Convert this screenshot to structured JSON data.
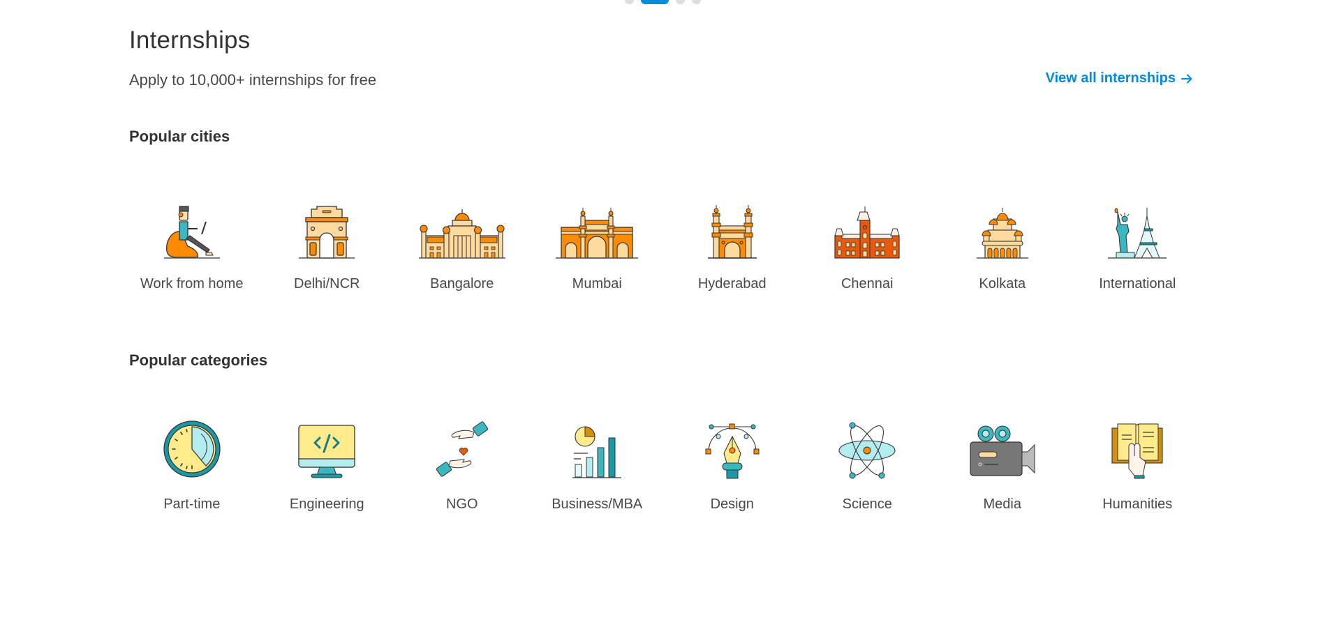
{
  "carousel": {
    "dot_count": 4,
    "active_index": 1
  },
  "header": {
    "title": "Internships",
    "subtitle": "Apply to 10,000+ internships for free",
    "view_all_label": "View all internships"
  },
  "colors": {
    "accent": "#008BDC",
    "heading": "#333333",
    "text": "#484848",
    "orange": "#FF8C00",
    "light_orange": "#FFDA9E",
    "teal": "#1A9AA6",
    "light_teal": "#B3EDF0",
    "yellow": "#FFEB8C"
  },
  "popular_cities": {
    "heading": "Popular cities",
    "items": [
      {
        "label": "Work from home",
        "icon": "person-laptop-icon"
      },
      {
        "label": "Delhi/NCR",
        "icon": "india-gate-icon"
      },
      {
        "label": "Bangalore",
        "icon": "vidhana-soudha-icon"
      },
      {
        "label": "Mumbai",
        "icon": "gateway-of-india-icon"
      },
      {
        "label": "Hyderabad",
        "icon": "charminar-icon"
      },
      {
        "label": "Chennai",
        "icon": "chennai-central-icon"
      },
      {
        "label": "Kolkata",
        "icon": "dakshineswar-temple-icon"
      },
      {
        "label": "International",
        "icon": "liberty-eiffel-icon"
      }
    ]
  },
  "popular_categories": {
    "heading": "Popular categories",
    "items": [
      {
        "label": "Part-time",
        "icon": "clock-icon"
      },
      {
        "label": "Engineering",
        "icon": "code-monitor-icon"
      },
      {
        "label": "NGO",
        "icon": "hands-heart-icon"
      },
      {
        "label": "Business/MBA",
        "icon": "bar-chart-icon"
      },
      {
        "label": "Design",
        "icon": "pen-tool-icon"
      },
      {
        "label": "Science",
        "icon": "atom-icon"
      },
      {
        "label": "Media",
        "icon": "video-camera-icon"
      },
      {
        "label": "Humanities",
        "icon": "open-book-icon"
      }
    ]
  }
}
